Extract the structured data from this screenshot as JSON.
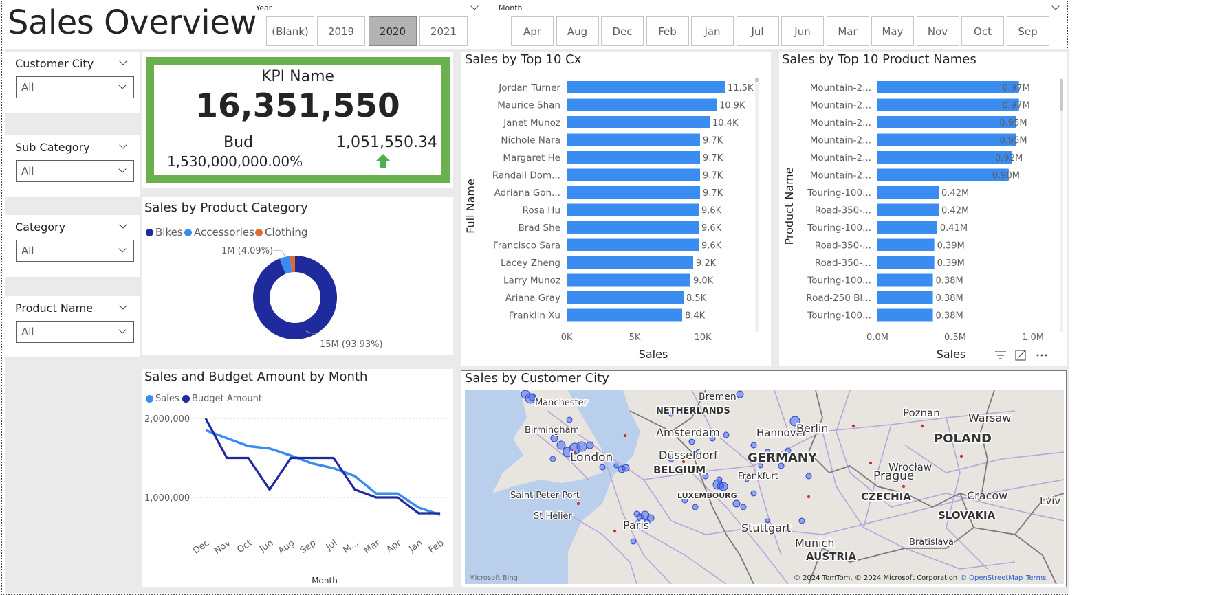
{
  "title": "Sales Overview",
  "year_slicer": {
    "label": "Year",
    "options": [
      "(Blank)",
      "2019",
      "2020",
      "2021"
    ],
    "selected": "2020"
  },
  "month_slicer": {
    "label": "Month",
    "options": [
      "Apr",
      "Aug",
      "Dec",
      "Feb",
      "Jan",
      "Jul",
      "Jun",
      "Mar",
      "May",
      "Nov",
      "Oct",
      "Sep"
    ]
  },
  "filters": [
    {
      "label": "Customer City",
      "value": "All"
    },
    {
      "label": "Sub Category",
      "value": "All"
    },
    {
      "label": "Category",
      "value": "All"
    },
    {
      "label": "Product Name",
      "value": "All"
    }
  ],
  "kpi": {
    "name": "KPI Name",
    "value": "16,351,550",
    "target_label": "Bud",
    "target_value": "1,051,550.34",
    "pct": "1,530,000,000.00%",
    "border_color": "#6ab04c",
    "arrow_color": "#4caf50"
  },
  "donut": {
    "title": "Sales by Product Category",
    "legend": [
      {
        "name": "Bikes",
        "color": "#1f2a9c"
      },
      {
        "name": "Accessories",
        "color": "#3b8cf0"
      },
      {
        "name": "Clothing",
        "color": "#e06a2c"
      }
    ],
    "label_small": "1M (4.09%)",
    "label_big": "15M (93.93%)"
  },
  "line_chart": {
    "title": "Sales and Budget Amount by Month",
    "legend": [
      {
        "name": "Sales",
        "color": "#3b8cf0"
      },
      {
        "name": "Budget Amount",
        "color": "#1f2a9c"
      }
    ],
    "yticks": [
      "2,000,000",
      "1,000,000"
    ],
    "xlabel": "Month"
  },
  "bar_cx": {
    "title": "Sales by Top 10 Cx",
    "ylabel": "Full Name",
    "xlabel": "Sales",
    "xticks": [
      "0K",
      "5K",
      "10K"
    ]
  },
  "bar_prod": {
    "title": "Sales by Top 10 Product Names",
    "ylabel": "Product Name",
    "xlabel": "Sales",
    "xticks": [
      "0.0M",
      "0.5M",
      "1.0M"
    ]
  },
  "map": {
    "title": "Sales by Customer City",
    "attribution": "© 2024 TomTom, © 2024 Microsoft Corporation",
    "osm": "© OpenStreetMap",
    "terms": "Terms",
    "bing": "Microsoft Bing",
    "labels": [
      "Bremen",
      "Manchester",
      "NETHERLANDS",
      "Poznan",
      "Warsaw",
      "Birmingham",
      "Amsterdam",
      "Hannover",
      "Berlin",
      "POLAND",
      "Düsseldorf",
      "London",
      "GERMANY",
      "BELGIUM",
      "Wrocław",
      "Frankfurt",
      "Prague",
      "Saint Peter Port",
      "LUXEMBOURG",
      "CZECHIA",
      "Cracow",
      "St Helier",
      "SLOVAKIA",
      "Lviv",
      "Paris",
      "Stuttgart",
      "Munich",
      "Bratislava",
      "AUSTRIA"
    ]
  },
  "chart_data": [
    {
      "type": "bar",
      "title": "Sales by Top 10 Cx",
      "xlabel": "Sales",
      "ylabel": "Full Name",
      "categories": [
        "Jordan Turner",
        "Maurice Shan",
        "Janet Munoz",
        "Nichole Nara",
        "Margaret He",
        "Randall Dom...",
        "Adriana Gon...",
        "Rosa Hu",
        "Brad She",
        "Francisco Sara",
        "Lacey Zheng",
        "Larry Munoz",
        "Ariana Gray",
        "Franklin Xu"
      ],
      "values": [
        11500,
        10900,
        10400,
        9700,
        9700,
        9700,
        9700,
        9600,
        9600,
        9600,
        9200,
        9000,
        8500,
        8400
      ],
      "data_labels": [
        "11.5K",
        "10.9K",
        "10.4K",
        "9.7K",
        "9.7K",
        "9.7K",
        "9.7K",
        "9.6K",
        "9.6K",
        "9.6K",
        "9.2K",
        "9.0K",
        "8.5K",
        "8.4K"
      ],
      "xlim": [
        0,
        13000
      ],
      "color": "#3b8cf0"
    },
    {
      "type": "bar",
      "title": "Sales by Top 10 Product Names",
      "xlabel": "Sales",
      "ylabel": "Product Name",
      "categories": [
        "Mountain-2...",
        "Mountain-2...",
        "Mountain-2...",
        "Mountain-2...",
        "Mountain-2...",
        "Mountain-2...",
        "Touring-100...",
        "Road-350-...",
        "Touring-100...",
        "Road-350-...",
        "Road-350-...",
        "Touring-100...",
        "Road-250 Bl...",
        "Touring-100..."
      ],
      "values": [
        0.97,
        0.97,
        0.95,
        0.95,
        0.92,
        0.9,
        0.42,
        0.42,
        0.41,
        0.39,
        0.39,
        0.38,
        0.38,
        0.38
      ],
      "data_labels": [
        "0.97M",
        "0.97M",
        "0.95M",
        "0.95M",
        "0.92M",
        "0.90M",
        "0.42M",
        "0.42M",
        "0.41M",
        "0.39M",
        "0.39M",
        "0.38M",
        "0.38M",
        "0.38M"
      ],
      "xlim": [
        0,
        1.0
      ],
      "color": "#3b8cf0"
    },
    {
      "type": "pie",
      "title": "Sales by Product Category",
      "categories": [
        "Bikes",
        "Accessories",
        "Clothing"
      ],
      "values": [
        93.93,
        4.09,
        1.98
      ]
    },
    {
      "type": "line",
      "title": "Sales and Budget Amount by Month",
      "xlabel": "Month",
      "categories": [
        "Dec",
        "Nov",
        "Oct",
        "Jun",
        "Aug",
        "Sep",
        "Jul",
        "M...",
        "Mar",
        "Apr",
        "Jan",
        "Feb"
      ],
      "series": [
        {
          "name": "Sales",
          "color": "#3b8cf0",
          "values": [
            1850000,
            1750000,
            1650000,
            1620000,
            1530000,
            1430000,
            1370000,
            1270000,
            1050000,
            1050000,
            870000,
            780000
          ]
        },
        {
          "name": "Budget Amount",
          "color": "#1f2a9c",
          "values": [
            2000000,
            1500000,
            1500000,
            1100000,
            1500000,
            1500000,
            1500000,
            1100000,
            1000000,
            1000000,
            800000,
            800000
          ]
        }
      ],
      "ylim": [
        0,
        2000000
      ]
    }
  ]
}
